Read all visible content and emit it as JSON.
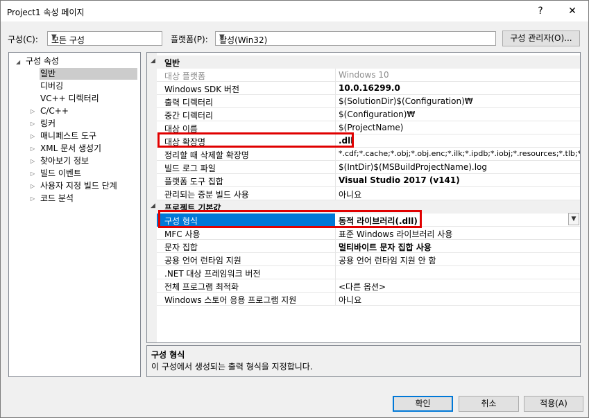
{
  "window": {
    "title": "Project1 속성 페이지",
    "help_label": "?",
    "close_label": "✕"
  },
  "toolbar": {
    "config_label": "구성(C):",
    "config_value": "모든 구성",
    "platform_label": "플랫폼(P):",
    "platform_value": "활성(Win32)",
    "config_manager_label": "구성 관리자(O)..."
  },
  "tree": {
    "root": "구성 속성",
    "items": [
      {
        "label": "일반",
        "expandable": false,
        "selected": true
      },
      {
        "label": "디버깅",
        "expandable": false
      },
      {
        "label": "VC++ 디렉터리",
        "expandable": false
      },
      {
        "label": "C/C++",
        "expandable": true
      },
      {
        "label": "링커",
        "expandable": true
      },
      {
        "label": "매니페스트 도구",
        "expandable": true
      },
      {
        "label": "XML 문서 생성기",
        "expandable": true
      },
      {
        "label": "찾아보기 정보",
        "expandable": true
      },
      {
        "label": "빌드 이벤트",
        "expandable": true
      },
      {
        "label": "사용자 지정 빌드 단계",
        "expandable": true
      },
      {
        "label": "코드 분석",
        "expandable": true
      }
    ]
  },
  "grid": {
    "categories": [
      {
        "name": "일반",
        "rows": [
          {
            "name": "대상 플랫폼",
            "value": "Windows 10",
            "disabled": true
          },
          {
            "name": "Windows SDK 버전",
            "value": "10.0.16299.0",
            "bold": true
          },
          {
            "name": "출력 디렉터리",
            "value": "$(SolutionDir)$(Configuration)₩"
          },
          {
            "name": "중간 디렉터리",
            "value": "$(Configuration)₩"
          },
          {
            "name": "대상 이름",
            "value": "$(ProjectName)"
          },
          {
            "name": "대상 확장명",
            "value": ".dll",
            "bold": true
          },
          {
            "name": "정리할 때 삭제할 확장명",
            "value": "*.cdf;*.cache;*.obj;*.obj.enc;*.ilk;*.ipdb;*.iobj;*.resources;*.tlb;*.tli;*.tl"
          },
          {
            "name": "빌드 로그 파일",
            "value": "$(IntDir)$(MSBuildProjectName).log"
          },
          {
            "name": "플랫폼 도구 집합",
            "value": "Visual Studio 2017 (v141)",
            "bold": true
          },
          {
            "name": "관리되는 증분 빌드 사용",
            "value": "아니요"
          }
        ]
      },
      {
        "name": "프로젝트 기본값",
        "rows": [
          {
            "name": "구성 형식",
            "value": "동적 라이브러리(.dll)",
            "bold": true,
            "selected": true
          },
          {
            "name": "MFC 사용",
            "value": "표준 Windows 라이브러리 사용"
          },
          {
            "name": "문자 집합",
            "value": "멀티바이트 문자 집합 사용",
            "bold": true
          },
          {
            "name": "공용 언어 런타임 지원",
            "value": "공용 언어 런타임 지원 안 함"
          },
          {
            "name": ".NET 대상 프레임워크 버전",
            "value": ""
          },
          {
            "name": "전체 프로그램 최적화",
            "value": "<다른 옵션>"
          },
          {
            "name": "Windows 스토어 응용 프로그램 지원",
            "value": "아니요"
          }
        ]
      }
    ]
  },
  "description": {
    "title": "구성 형식",
    "text": "이 구성에서 생성되는 출력 형식을 지정합니다."
  },
  "buttons": {
    "ok": "확인",
    "cancel": "취소",
    "apply": "적용(A)"
  },
  "highlight_color": "#e00000",
  "selection_color": "#0078d7"
}
